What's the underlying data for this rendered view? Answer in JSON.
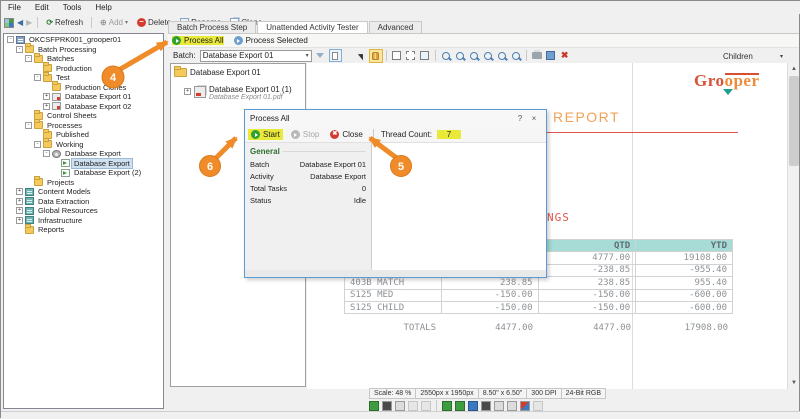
{
  "menubar": {
    "items": [
      "File",
      "Edit",
      "Tools",
      "Help"
    ]
  },
  "main_toolbar": {
    "refresh": "Refresh",
    "add": "Add",
    "delete": "Delete",
    "rename": "Rename",
    "clone": "Clone"
  },
  "tree": {
    "items": [
      {
        "label": "OKCSFPRK001_grooper01",
        "level": 0,
        "exp": "-",
        "icon": "server"
      },
      {
        "label": "Batch Processing",
        "level": 1,
        "exp": "-",
        "icon": "folder-gear"
      },
      {
        "label": "Batches",
        "level": 2,
        "exp": "-",
        "icon": "folder"
      },
      {
        "label": "Production",
        "level": 3,
        "exp": null,
        "icon": "folder"
      },
      {
        "label": "Test",
        "level": 3,
        "exp": "-",
        "icon": "folder"
      },
      {
        "label": "Production Clones",
        "level": 4,
        "exp": null,
        "icon": "folder"
      },
      {
        "label": "Database Export 01",
        "level": 4,
        "exp": "+",
        "icon": "pages"
      },
      {
        "label": "Database Export 02",
        "level": 4,
        "exp": "+",
        "icon": "pages"
      },
      {
        "label": "Control Sheets",
        "level": 2,
        "exp": null,
        "icon": "folder"
      },
      {
        "label": "Processes",
        "level": 2,
        "exp": "-",
        "icon": "folder"
      },
      {
        "label": "Published",
        "level": 3,
        "exp": null,
        "icon": "folder"
      },
      {
        "label": "Working",
        "level": 3,
        "exp": "-",
        "icon": "folder"
      },
      {
        "label": "Database Export",
        "level": 4,
        "exp": "-",
        "icon": "gear"
      },
      {
        "label": "Database Export",
        "level": 5,
        "exp": null,
        "icon": "doc-green",
        "selected": true
      },
      {
        "label": "Database Export (2)",
        "level": 5,
        "exp": null,
        "icon": "doc-green"
      },
      {
        "label": "Projects",
        "level": 2,
        "exp": null,
        "icon": "folder"
      },
      {
        "label": "Content Models",
        "level": 1,
        "exp": "+",
        "icon": "stack"
      },
      {
        "label": "Data Extraction",
        "level": 1,
        "exp": "+",
        "icon": "stack"
      },
      {
        "label": "Global Resources",
        "level": 1,
        "exp": "+",
        "icon": "stack"
      },
      {
        "label": "Infrastructure",
        "level": 1,
        "exp": "+",
        "icon": "stack"
      },
      {
        "label": "Reports",
        "level": 1,
        "exp": null,
        "icon": "folder"
      }
    ]
  },
  "tabs": [
    "Batch Process Step",
    "Unattended Activity Tester",
    "Advanced"
  ],
  "process_row": {
    "process_all": "Process All",
    "process_selected": "Process Selected"
  },
  "batch_row": {
    "label": "Batch:",
    "value": "Database Export 01"
  },
  "viewer_toolbar_icons": [
    "select-pointer",
    "pan-hand",
    "add-region",
    "zoom-rect",
    "zoom-page",
    "zoom-in",
    "zoom-out",
    "zoom-selection",
    "zoom-fit",
    "zoom-width",
    "zoom-height",
    "print",
    "export",
    "clear-red"
  ],
  "children_dropdown": {
    "value": "Children"
  },
  "batch_tree": {
    "folder": "Database Export 01",
    "doc_title": "Database Export 01 (1)",
    "doc_file": "Database Export 01.pdf"
  },
  "document": {
    "logo_part1": "Gro",
    "logo_part2": "oper",
    "title": "REPORT",
    "section_fragment": "NGS",
    "table": {
      "headers": [
        "",
        "",
        "QTD",
        "YTD"
      ],
      "rows": [
        [
          "",
          "",
          "4777.00",
          "19108.00"
        ],
        [
          "",
          "",
          "-238.85",
          "-955.40"
        ],
        [
          "403B MATCH",
          "238.85",
          "238.85",
          "955.40"
        ],
        [
          "S125 MED",
          "-150.00",
          "-150.00",
          "-600.00"
        ],
        [
          "S125 CHILD",
          "-150.00",
          "-150.00",
          "-600.00"
        ]
      ],
      "totals": [
        "TOTALS",
        "4477.00",
        "4477.00",
        "17908.00"
      ],
      "header_color": "#a6dbd6"
    }
  },
  "dialog": {
    "title": "Process All",
    "help_button": "?",
    "close_button": "×",
    "toolbar": {
      "start": "Start",
      "stop": "Stop",
      "close": "Close",
      "thread_count_label": "Thread Count:",
      "thread_count_value": "7"
    },
    "general": {
      "label": "General",
      "rows": [
        {
          "name": "Batch",
          "value": "Database Export 01"
        },
        {
          "name": "Activity",
          "value": "Database Export"
        },
        {
          "name": "Total Tasks",
          "value": "0"
        },
        {
          "name": "Status",
          "value": "Idle"
        }
      ]
    }
  },
  "status_segments": [
    "Scale: 48 %",
    "2550px x 1950px",
    "8.50\" x 6.50\"",
    "300 DPI",
    "24-Bit RGB"
  ],
  "image_toolbar_icons": [
    "view-image",
    "view-dark",
    "view-gray",
    "expand-disabled",
    "close-disabled",
    "rotate-left",
    "rotate-right",
    "flip",
    "invert",
    "crop",
    "copy-region",
    "color-adjust",
    "undo"
  ],
  "callouts": [
    {
      "number": "4"
    },
    {
      "number": "5"
    },
    {
      "number": "6"
    }
  ],
  "highlight_color": "#e9e93a",
  "callout_color": "#ef8b28"
}
